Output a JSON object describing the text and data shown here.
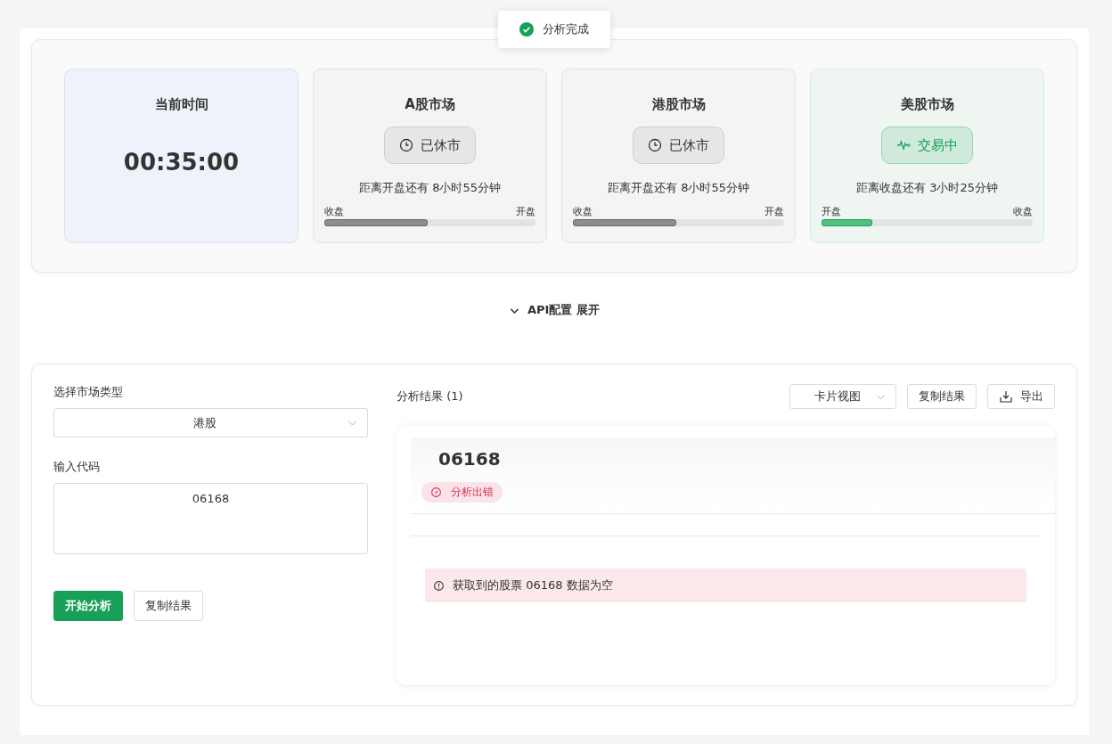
{
  "toast": {
    "text": "分析完成"
  },
  "markets": [
    {
      "kind": "clock",
      "title": "当前时间",
      "time": "00:35:00"
    },
    {
      "kind": "market",
      "title": "A股市场",
      "open": false,
      "status_text": "已休市",
      "countdown": "距离开盘还有 8小时55分钟",
      "left_label": "收盘",
      "right_label": "开盘",
      "level": 0.49
    },
    {
      "kind": "market",
      "title": "港股市场",
      "open": false,
      "status_text": "已休市",
      "countdown": "距离开盘还有 8小时55分钟",
      "left_label": "收盘",
      "right_label": "开盘",
      "level": 0.49
    },
    {
      "kind": "market",
      "title": "美股市场",
      "open": true,
      "status_text": "交易中",
      "countdown": "距离收盘还有 3小时25分钟",
      "left_label": "开盘",
      "right_label": "收盘",
      "level": 0.24
    }
  ],
  "api_toggle": {
    "label": "API配置 展开",
    "expanded": false
  },
  "form": {
    "market_label": "选择市场类型",
    "market_value": "港股",
    "code_label": "输入代码",
    "code_value": "06168",
    "buttons": [
      {
        "label": "开始分析",
        "kind": "primary"
      },
      {
        "label": "复制结果",
        "kind": "default"
      }
    ]
  },
  "results": {
    "title": "分析结果 (1)",
    "view_select": "卡片视图",
    "copy_button": "复制结果",
    "export_button": "导出",
    "cards": [
      {
        "code": "06168",
        "error": true,
        "status_text": "分析出错",
        "message": "获取到的股票 06168 数据为空"
      }
    ]
  }
}
